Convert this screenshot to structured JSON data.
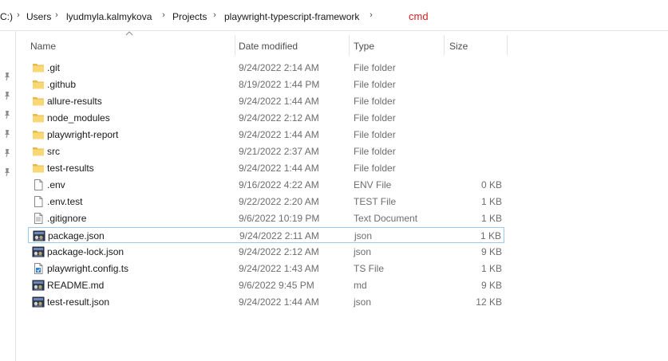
{
  "breadcrumb": {
    "drive_fragment": "C:)",
    "items": [
      "Users",
      "lyudmyla.kalmykova",
      "Projects",
      "playwright-typescript-framework"
    ],
    "annotation": "cmd"
  },
  "columns": {
    "name": "Name",
    "date_modified": "Date modified",
    "type": "Type",
    "size": "Size"
  },
  "files": [
    {
      "name": ".git",
      "date": "9/24/2022 2:14 AM",
      "type": "File folder",
      "size": "",
      "icon": "folder-icon"
    },
    {
      "name": ".github",
      "date": "8/19/2022 1:44 PM",
      "type": "File folder",
      "size": "",
      "icon": "folder-icon"
    },
    {
      "name": "allure-results",
      "date": "9/24/2022 1:44 AM",
      "type": "File folder",
      "size": "",
      "icon": "folder-icon"
    },
    {
      "name": "node_modules",
      "date": "9/24/2022 2:12 AM",
      "type": "File folder",
      "size": "",
      "icon": "folder-icon"
    },
    {
      "name": "playwright-report",
      "date": "9/24/2022 1:44 AM",
      "type": "File folder",
      "size": "",
      "icon": "folder-icon"
    },
    {
      "name": "src",
      "date": "9/21/2022 2:37 AM",
      "type": "File folder",
      "size": "",
      "icon": "folder-icon"
    },
    {
      "name": "test-results",
      "date": "9/24/2022 1:44 AM",
      "type": "File folder",
      "size": "",
      "icon": "folder-icon"
    },
    {
      "name": ".env",
      "date": "9/16/2022 4:22 AM",
      "type": "ENV File",
      "size": "0 KB",
      "icon": "blank-file-icon"
    },
    {
      "name": ".env.test",
      "date": "9/22/2022 2:20 AM",
      "type": "TEST File",
      "size": "1 KB",
      "icon": "blank-file-icon"
    },
    {
      "name": ".gitignore",
      "date": "9/6/2022 10:19 PM",
      "type": "Text Document",
      "size": "1 KB",
      "icon": "text-file-icon"
    },
    {
      "name": "package.json",
      "date": "9/24/2022 2:11 AM",
      "type": "json",
      "size": "1 KB",
      "icon": "app-file-icon",
      "selected": true
    },
    {
      "name": "package-lock.json",
      "date": "9/24/2022 2:12 AM",
      "type": "json",
      "size": "9 KB",
      "icon": "app-file-icon"
    },
    {
      "name": "playwright.config.ts",
      "date": "9/24/2022 1:43 AM",
      "type": "TS File",
      "size": "1 KB",
      "icon": "ts-file-icon"
    },
    {
      "name": "README.md",
      "date": "9/6/2022 9:45 PM",
      "type": "md",
      "size": "9 KB",
      "icon": "app-file-icon"
    },
    {
      "name": "test-result.json",
      "date": "9/24/2022 1:44 AM",
      "type": "json",
      "size": "12 KB",
      "icon": "app-file-icon"
    }
  ],
  "colors": {
    "folder": "#f8d775",
    "folder_dark": "#e8b84a",
    "selection_border": "#9fc8ea",
    "annotation_red": "#d42020"
  }
}
